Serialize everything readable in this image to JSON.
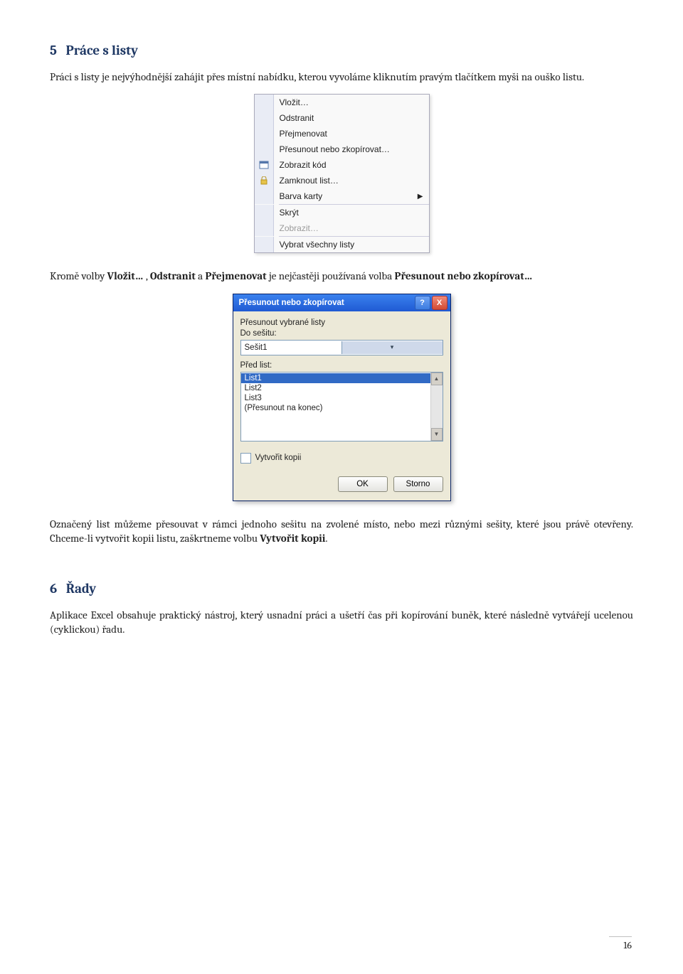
{
  "section1": {
    "number": "5",
    "title": "Práce s listy",
    "intro": "Práci s listy je nejvýhodnější zahájit přes místní nabídku, kterou vyvoláme kliknutím pravým tlačítkem myši na ouško listu."
  },
  "context_menu": {
    "vlozit": "Vložit…",
    "odstranit": "Odstranit",
    "prejmenovat": "Přejmenovat",
    "presunout": "Přesunout nebo zkopírovat…",
    "zobrazit_kod": "Zobrazit kód",
    "zamknout": "Zamknout list…",
    "barva": "Barva karty",
    "skryt": "Skrýt",
    "zobrazit": "Zobrazit…",
    "vybrat": "Vybrat všechny listy"
  },
  "para_vlozit": {
    "pre": "Kromě volby ",
    "b1": "Vložit…",
    "mid1": " , ",
    "b2": "Odstranit",
    "mid2": " a ",
    "b3": "Přejmenovat",
    "mid3": " je nejčastěji používaná volba ",
    "b4": "Přesunout nebo zkopírovat…"
  },
  "dialog": {
    "title": "Přesunout nebo zkopírovat",
    "label_to_book": "Přesunout vybrané listy",
    "label_do": "Do sešitu:",
    "combo_value": "Sešit1",
    "label_pred": "Před list:",
    "items": [
      "List1",
      "List2",
      "List3",
      "(Přesunout na konec)"
    ],
    "selected_index": 0,
    "checkbox": "Vytvořit kopii",
    "ok": "OK",
    "storno": "Storno"
  },
  "para_after_dialog": {
    "t1": "Označený list můžeme přesouvat v rámci jednoho sešitu na zvolené místo, nebo mezi různými sešity, které jsou právě otevřeny. Chceme-li vytvořit kopii listu, zaškrtneme volbu ",
    "b1": "Vytvořit kopii",
    "t2": "."
  },
  "section2": {
    "number": "6",
    "title": "Řady",
    "para": "Aplikace Excel obsahuje praktický nástroj, který usnadní práci a ušetří čas při kopírování buněk, které následně vytvářejí ucelenou (cyklickou) řadu."
  },
  "page_number": "16"
}
